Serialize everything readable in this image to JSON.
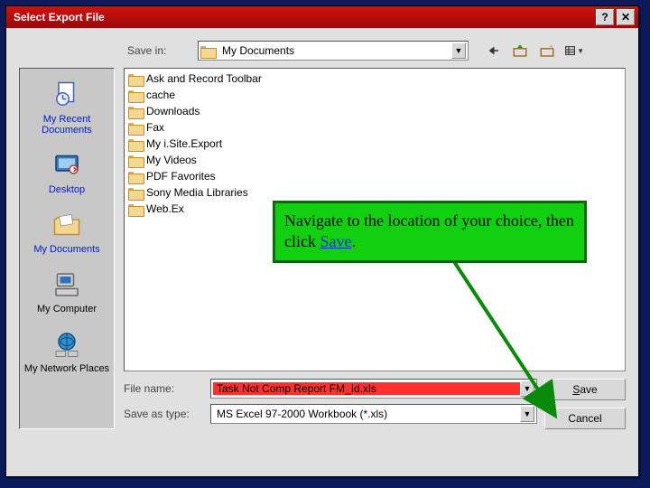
{
  "title": "Select Export File",
  "topbar": {
    "save_in_label": "Save in:",
    "save_in_value": "My Documents"
  },
  "places": [
    {
      "label": "My Recent Documents"
    },
    {
      "label": "Desktop"
    },
    {
      "label": "My Documents"
    },
    {
      "label": "My Computer"
    },
    {
      "label": "My Network Places"
    }
  ],
  "folders": [
    "Ask and Record Toolbar",
    "cache",
    "Downloads",
    "Fax",
    "My i.Site.Export",
    "My Videos",
    "PDF Favorites",
    "Sony Media Libraries",
    "Web.Ex"
  ],
  "fields": {
    "filename_label": "File name:",
    "filename_value": "Task Not Comp Report FM_Id.xls",
    "type_label": "Save as type:",
    "type_value": "MS Excel 97-2000 Workbook (*.xls)"
  },
  "buttons": {
    "save": "Save",
    "cancel": "Cancel"
  },
  "callout": {
    "text1": "Navigate to the location of your choice, then click ",
    "savetext": "Save",
    "text2": "."
  }
}
